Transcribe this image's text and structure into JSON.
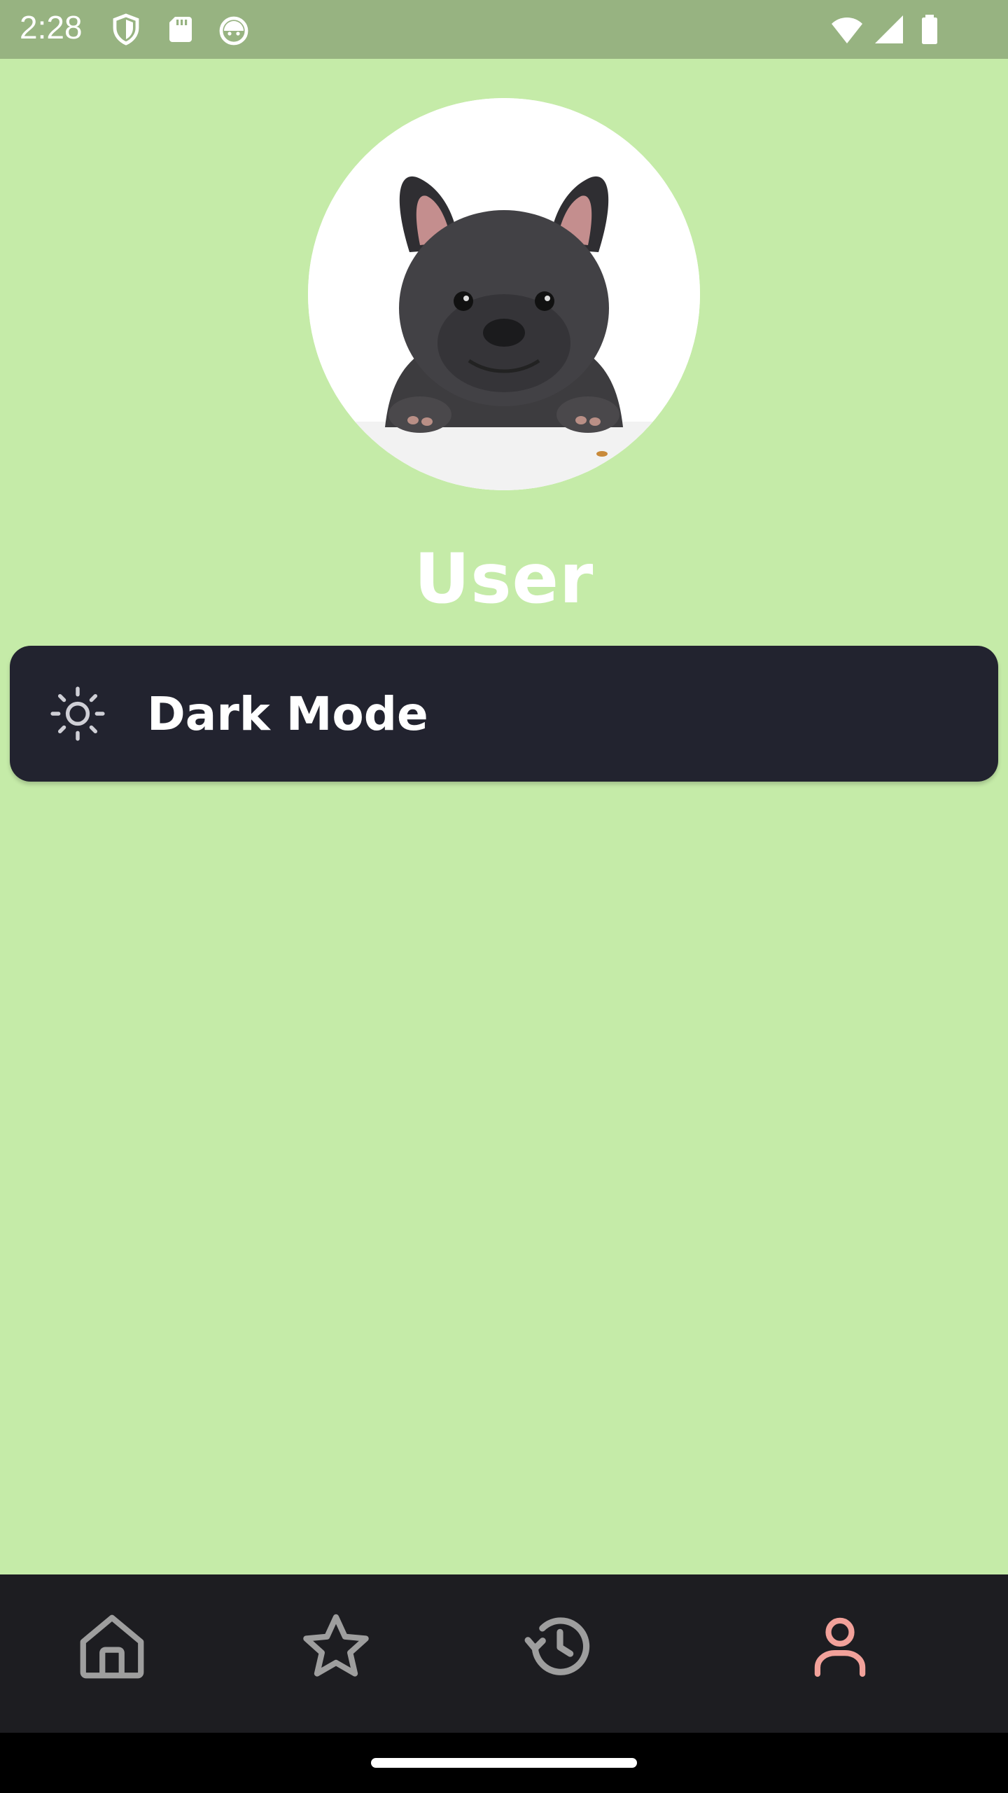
{
  "status_bar": {
    "time": "2:28",
    "left_icons": [
      "shield-icon",
      "sd-card-icon",
      "android-face-icon"
    ],
    "right_icons": [
      "wifi-icon",
      "cell-signal-icon",
      "battery-icon"
    ],
    "color": "#97b381"
  },
  "profile": {
    "avatar": "french-bulldog-photo",
    "username": "User"
  },
  "settings": {
    "dark_mode": {
      "icon": "sun-icon",
      "label": "Dark Mode"
    }
  },
  "bottom_nav": {
    "items": [
      {
        "icon": "home-icon",
        "active": false
      },
      {
        "icon": "star-icon",
        "active": false
      },
      {
        "icon": "history-icon",
        "active": false
      },
      {
        "icon": "person-icon",
        "active": true
      }
    ],
    "active_color": "#f2a19a",
    "inactive_color": "#9e9e9e"
  },
  "colors": {
    "background": "#c5eba8",
    "card": "#22232f",
    "nav_bar": "#1d1d21"
  }
}
